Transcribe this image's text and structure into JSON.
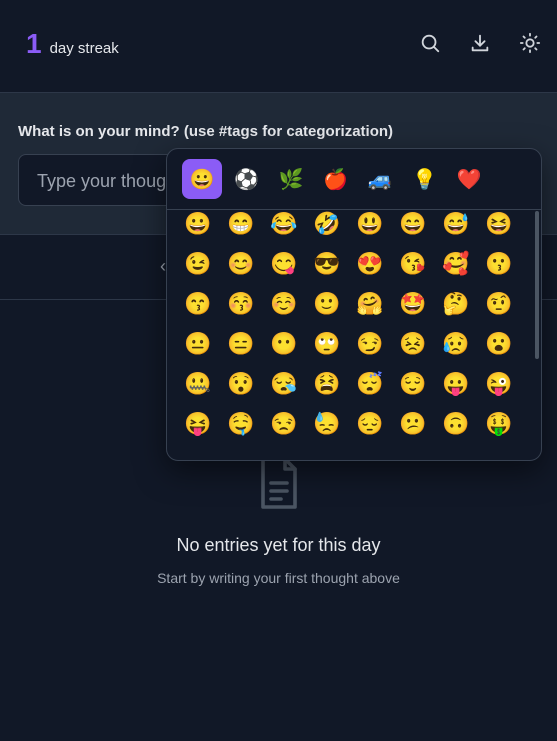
{
  "header": {
    "streak_count": "1",
    "streak_label": "day streak",
    "icons": [
      "search-icon",
      "download-icon",
      "sun-icon"
    ]
  },
  "compose": {
    "label": "What is on your mind? (use #tags for categorization)",
    "placeholder": "Type your thoughts here..."
  },
  "date_nav": {
    "prev_glyph": "‹"
  },
  "empty_state": {
    "title": "No entries yet for this day",
    "subtitle": "Start by writing your first thought above"
  },
  "emoji_picker": {
    "categories": [
      {
        "name": "smileys",
        "glyph": "😀",
        "active": true
      },
      {
        "name": "activities",
        "glyph": "⚽",
        "active": false
      },
      {
        "name": "nature",
        "glyph": "🌿",
        "active": false
      },
      {
        "name": "food",
        "glyph": "🍎",
        "active": false
      },
      {
        "name": "travel",
        "glyph": "🚙",
        "active": false
      },
      {
        "name": "objects",
        "glyph": "💡",
        "active": false
      },
      {
        "name": "symbols",
        "glyph": "❤️",
        "active": false
      }
    ],
    "emojis": [
      [
        "😀",
        "😁",
        "😂",
        "🤣",
        "😃",
        "😄",
        "😅",
        "😆"
      ],
      [
        "😉",
        "😊",
        "😋",
        "😎",
        "😍",
        "😘",
        "🥰",
        "😗"
      ],
      [
        "😙",
        "😚",
        "☺️",
        "🙂",
        "🤗",
        "🤩",
        "🤔",
        "🤨"
      ],
      [
        "😐",
        "😑",
        "😶",
        "🙄",
        "😏",
        "😣",
        "😥",
        "😮"
      ],
      [
        "🤐",
        "😯",
        "😪",
        "😫",
        "😴",
        "😌",
        "😛",
        "😜"
      ],
      [
        "😝",
        "🤤",
        "😒",
        "😓",
        "😔",
        "😕",
        "🙃",
        "🤑"
      ]
    ]
  }
}
